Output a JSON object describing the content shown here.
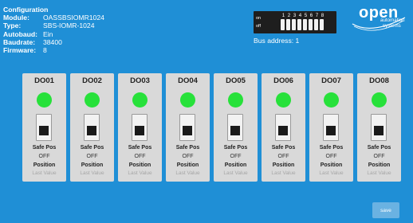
{
  "configuration": {
    "title": "Configuration",
    "rows": [
      {
        "key": "Module:",
        "value": "OASSBSIOMR1024"
      },
      {
        "key": "Type:",
        "value": "SBS-IOMR-1024"
      },
      {
        "key": "Autobaud:",
        "value": "Ein"
      },
      {
        "key": "Baudrate:",
        "value": "38400"
      },
      {
        "key": "Firmware:",
        "value": "8"
      }
    ]
  },
  "dip_switch": {
    "on_label": "on",
    "off_label": "off",
    "numbers": [
      "1",
      "2",
      "3",
      "4",
      "5",
      "6",
      "7",
      "8"
    ],
    "bus_address": "Bus address: 1"
  },
  "logo": {
    "brand": "open",
    "line1": "automation",
    "line2": "systems"
  },
  "channels": [
    {
      "name": "DO01",
      "safe_label": "Safe Pos",
      "safe_value": "OFF",
      "position_label": "Position",
      "position_value": "Last Value",
      "led_color": "#27e13a"
    },
    {
      "name": "DO02",
      "safe_label": "Safe Pos",
      "safe_value": "OFF",
      "position_label": "Position",
      "position_value": "Last Value",
      "led_color": "#27e13a"
    },
    {
      "name": "DO03",
      "safe_label": "Safe Pos",
      "safe_value": "OFF",
      "position_label": "Position",
      "position_value": "Last Value",
      "led_color": "#27e13a"
    },
    {
      "name": "DO04",
      "safe_label": "Safe Pos",
      "safe_value": "OFF",
      "position_label": "Position",
      "position_value": "Last Value",
      "led_color": "#27e13a"
    },
    {
      "name": "DO05",
      "safe_label": "Safe Pos",
      "safe_value": "OFF",
      "position_label": "Position",
      "position_value": "Last Value",
      "led_color": "#27e13a"
    },
    {
      "name": "DO06",
      "safe_label": "Safe Pos",
      "safe_value": "OFF",
      "position_label": "Position",
      "position_value": "Last Value",
      "led_color": "#27e13a"
    },
    {
      "name": "DO07",
      "safe_label": "Safe Pos",
      "safe_value": "OFF",
      "position_label": "Position",
      "position_value": "Last Value",
      "led_color": "#27e13a"
    },
    {
      "name": "DO08",
      "safe_label": "Safe Pos",
      "safe_value": "OFF",
      "position_label": "Position",
      "position_value": "Last Value",
      "led_color": "#27e13a"
    }
  ],
  "save_label": "save",
  "colors": {
    "background": "#1f8fd6",
    "card": "#d9d9d9",
    "led_on": "#27e13a",
    "save_button": "#6ab2e2"
  }
}
